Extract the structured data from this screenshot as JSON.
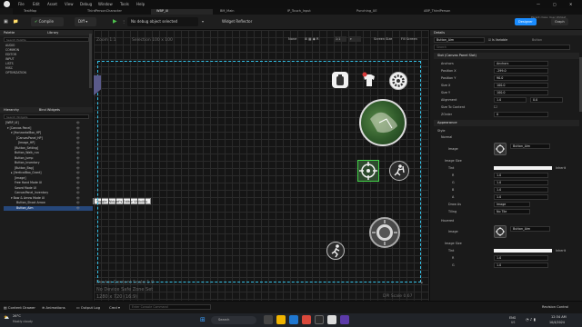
{
  "menu": [
    "File",
    "Edit",
    "Asset",
    "View",
    "Debug",
    "Window",
    "Tools",
    "Help"
  ],
  "tabs": [
    "TestMap",
    "ThirdPersonCharacter",
    "WBP_UI",
    "BM_Main",
    "IP_Touch_Input",
    "Punching_UE",
    "ABP_ThirdPerson"
  ],
  "toolbar": {
    "compile": "Compile",
    "diff": "Diff ▾",
    "debug_object": "No debug object selected",
    "widget_reflector": "Widget Reflector",
    "designer": "Designer",
    "graph": "Graph",
    "parent_class": "Parent class: User Widget"
  },
  "left": {
    "palette": "Palette",
    "library": "Library",
    "search_palette": "Search Palette",
    "categories": [
      "AUDIO",
      "COMMON",
      "EDITOR",
      "INPUT",
      "LISTS",
      "MISC",
      "OPTIMIZATION"
    ],
    "hierarchy": "Hierarchy",
    "bind_widgets": "Bind Widgets",
    "search_widgets": "Search Widgets",
    "tree": [
      "[WBP_UI]",
      "▾ [Canvas Panel]",
      "▾ [HorizontalBox_HP]",
      "[CanvasPanel_HP]",
      "[Image_HP]",
      "[Button_Setting]",
      "Button_Walk_run",
      "Button_Jump",
      "Button_Inventory",
      "[Button_Bag]",
      "▸ [VerticalBox_Grant]",
      "[Image]",
      "Free Hand Mode UI",
      "Sword Mode UI",
      "CanvasPanel_Inventory",
      "▾ Bow & Arrow Mode UI",
      "Button_Shoot Arrow",
      "Button_Aim"
    ],
    "tooltip": "Toggle Widget's Editor Visibility"
  },
  "viewport": {
    "zoom": "Zoom 1:1",
    "selection": "Selection 100 x 100",
    "none_label": "None",
    "screen_size": "Screen Size",
    "fill_screen": "Fill Screen",
    "safe_zone": "Device Content Scale 1.0",
    "no_safe_zone": "No Device Safe Zone Set",
    "resolution": "1280 x 720 (16:9)",
    "dpi": "DPI Scale 0.67"
  },
  "details": {
    "title": "Details",
    "name": "Button_Aim",
    "is_variable": "Is Variable",
    "type": "Button",
    "search": "Search",
    "slot_section": "Slot (Canvas Panel Slot)",
    "rows": [
      {
        "label": "Anchors",
        "v1": "Anchors",
        "v2": ""
      },
      {
        "label": "Position X",
        "v1": "-299.0",
        "v2": ""
      },
      {
        "label": "Position Y",
        "v1": "90.0",
        "v2": ""
      },
      {
        "label": "Size X",
        "v1": "100.0",
        "v2": ""
      },
      {
        "label": "Size Y",
        "v1": "100.0",
        "v2": ""
      },
      {
        "label": "Alignment",
        "v1": "1.0",
        "v2": "0.0"
      },
      {
        "label": "Size To Content",
        "v1": "",
        "v2": ""
      },
      {
        "label": "ZOrder",
        "v1": "0",
        "v2": ""
      }
    ],
    "appearance": "Appearance",
    "style": "Style",
    "normal": "Normal",
    "image": "Image",
    "image_value": "Button_Aim",
    "image_size": "Image Size",
    "tint": "Tint",
    "inherit": "Inherit",
    "channel_vals": [
      "1.0",
      "1.0",
      "1.0",
      "1.0"
    ],
    "draw_as": "Draw As",
    "draw_as_val": "Image",
    "tiling": "Tiling",
    "tiling_val": "No Tile",
    "hovered": "Hovered",
    "hovered_image": "Button_Aim"
  },
  "status": {
    "content_drawer": "Content Drawer",
    "animations": "Animations",
    "output_log": "Output Log",
    "cmd": "Cmd ▾",
    "console_placeholder": "Enter Console Command",
    "source_control": "Revision Control"
  },
  "taskbar": {
    "temp": "26°C",
    "weather": "Mostly cloudy",
    "search": "Search",
    "lang": "ENG",
    "lang2": "US",
    "time": "12:34 AM",
    "date": "10/4/2024"
  },
  "colors": {
    "accent": "#1a8cff",
    "selection": "#26477a",
    "safe_zone": "#34c2e8",
    "selected_widget": "#44d34a"
  }
}
